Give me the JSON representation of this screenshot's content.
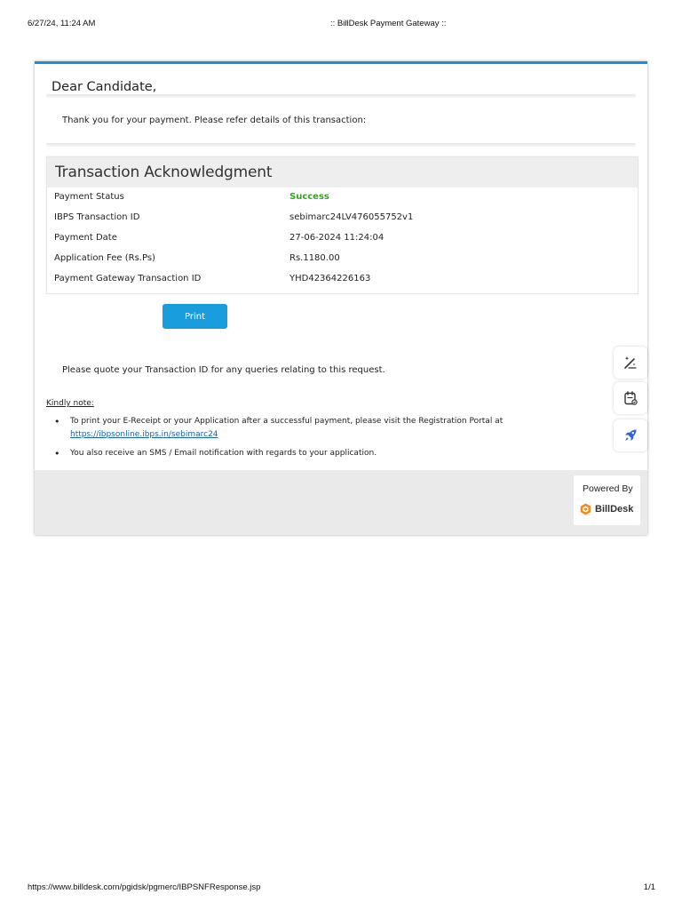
{
  "print_header": {
    "datetime": "6/27/24, 11:24 AM",
    "title": ":: BillDesk Payment Gateway ::"
  },
  "print_footer": {
    "url": "https://www.billdesk.com/pgidsk/pgmerc/IBPSNFResponse.jsp",
    "page": "1/1"
  },
  "greeting": "Dear Candidate,",
  "thanks_text": "Thank you for your payment. Please refer details of this transaction:",
  "acknowledgment": {
    "title": "Transaction Acknowledgment",
    "rows": [
      {
        "label": "Payment Status",
        "value": "Success"
      },
      {
        "label": "IBPS Transaction ID",
        "value": "sebimarc24LV476055752v1"
      },
      {
        "label": "Payment Date",
        "value": "27-06-2024 11:24:04"
      },
      {
        "label": "Application Fee (Rs.Ps)",
        "value": "Rs.1180.00"
      },
      {
        "label": "Payment Gateway Transaction ID",
        "value": "YHD42364226163"
      }
    ]
  },
  "print_button_label": "Print",
  "quote_text": "Please quote your Transaction ID for any queries relating to this request.",
  "kindly_note_label": "Kindly note:",
  "notes": {
    "item1_text": "To print your E-Receipt or your Application after a successful payment, please visit the Registration Portal at",
    "item1_link": "https://ibpsonline.ibps.in/sebimarc24",
    "item2_text": "You also receive an SMS / Email notification with regards to your application."
  },
  "powered_by": {
    "label": "Powered By",
    "brand": "BillDesk"
  },
  "side_tools": {
    "icons": [
      "magic-wand-icon",
      "notes-icon",
      "rocket-icon"
    ]
  },
  "colors": {
    "accent": "#1c8fd6",
    "button": "#1a9ddc",
    "success": "#2eaa16",
    "link": "#1a5fb4",
    "logo_orange": "#f08c1e",
    "tool_blue": "#2b63e0"
  }
}
